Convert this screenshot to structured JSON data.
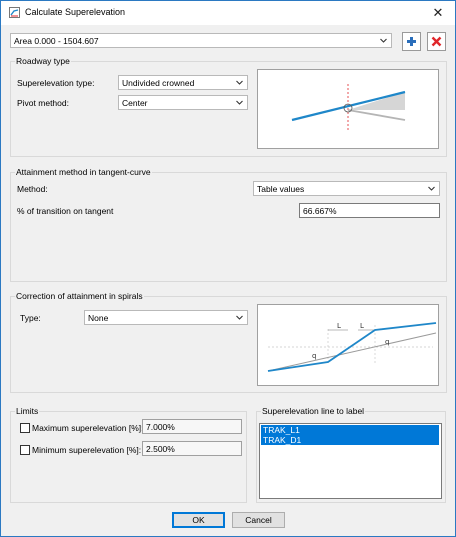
{
  "window": {
    "title": "Calculate Superelevation",
    "close_glyph": "✕"
  },
  "area": {
    "selected": "Area 0.000 - 1504.607",
    "add_icon": "plus-icon",
    "remove_icon": "x-icon"
  },
  "roadway_type": {
    "group_label": "Roadway type",
    "superelevation_type_label": "Superelevation type:",
    "superelevation_type_value": "Undivided crowned",
    "pivot_method_label": "Pivot method:",
    "pivot_method_value": "Center"
  },
  "attainment": {
    "group_label": "Attainment method in tangent-curve",
    "method_label": "Method:",
    "method_value": "Table values",
    "transition_label": "% of transition on tangent",
    "transition_value": "66.667%"
  },
  "spiral_correction": {
    "group_label": "Correction of attainment in spirals",
    "type_label": "Type:",
    "type_value": "None",
    "diagram_labels": {
      "l1": "L",
      "l2": "L",
      "q1": "q",
      "q2": "q"
    }
  },
  "limits": {
    "group_label": "Limits",
    "max_label": "Maximum superelevation [%]:",
    "max_value": "7.000%",
    "min_label": "Minimum superelevation [%]:",
    "min_value": "2.500%"
  },
  "label_lines": {
    "group_label": "Superelevation line to label",
    "items": [
      "TRAK_L1",
      "TRAK_D1"
    ]
  },
  "buttons": {
    "ok": "OK",
    "cancel": "Cancel"
  },
  "colors": {
    "accent": "#0078d7",
    "line_blue": "#1f87c9",
    "remove_red": "#e0262b",
    "add_blue": "#2a6ebb"
  }
}
